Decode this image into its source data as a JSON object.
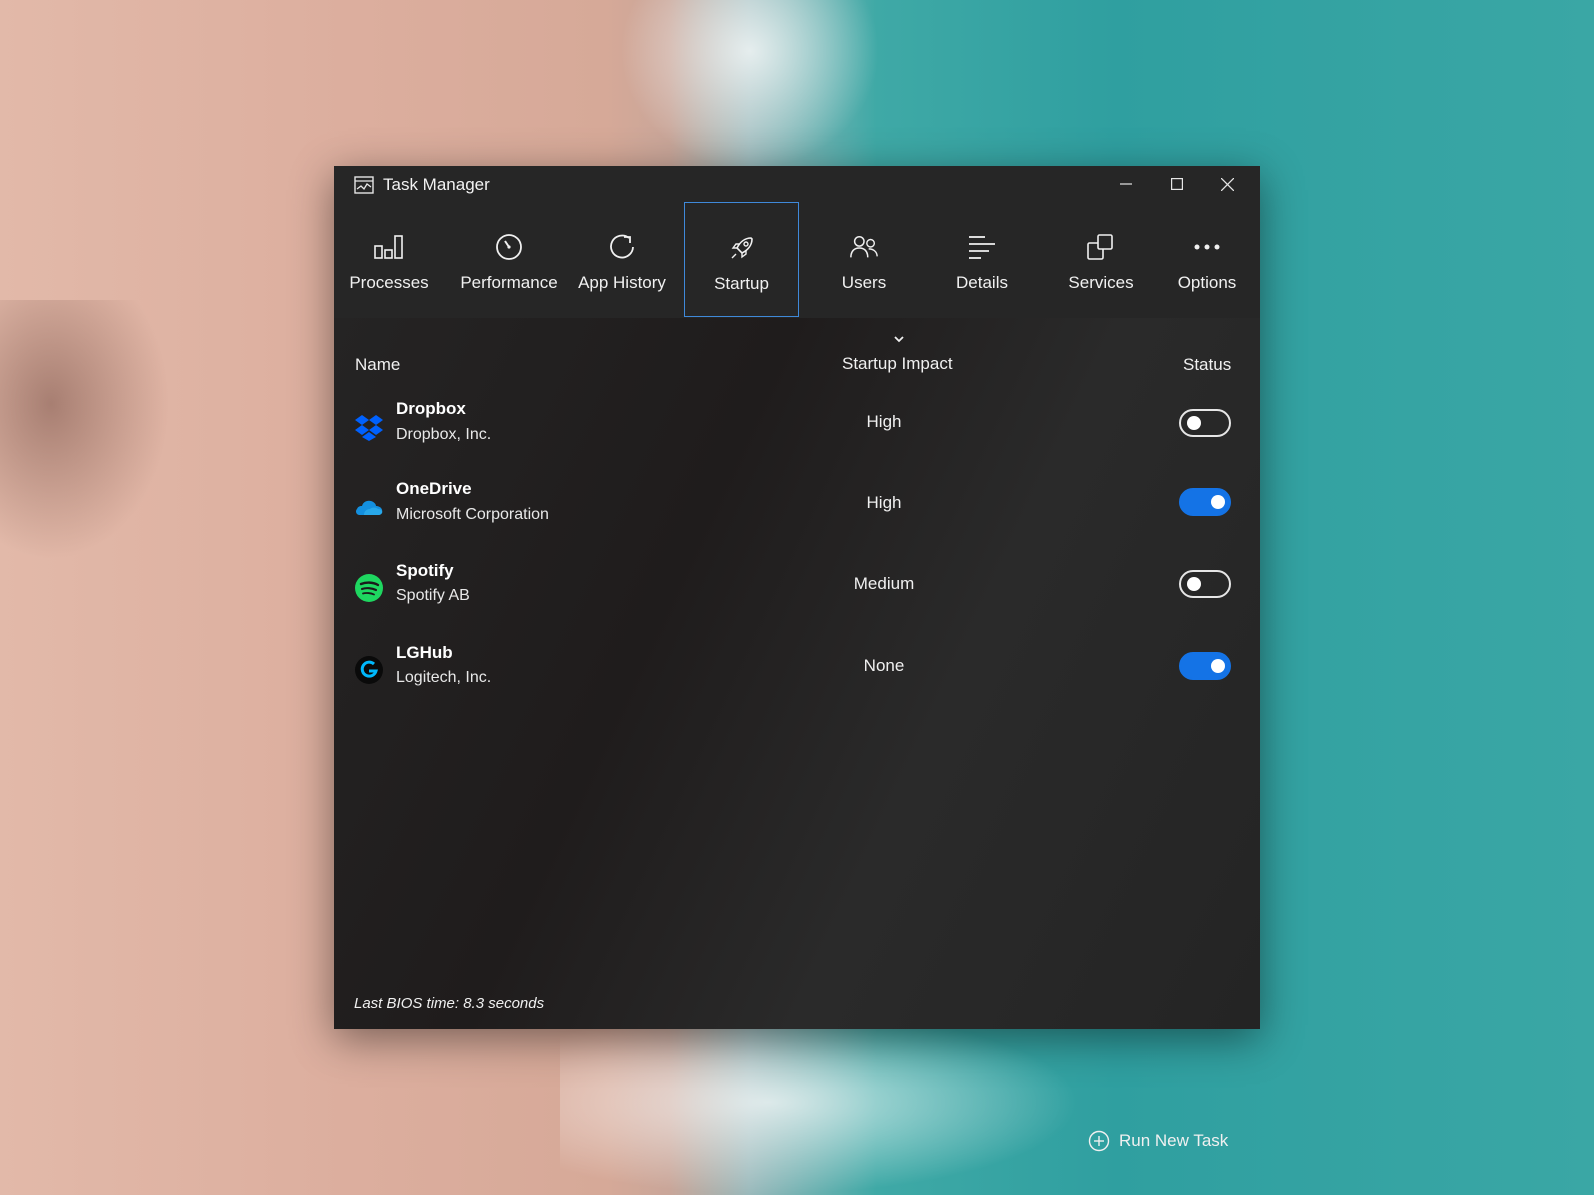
{
  "window": {
    "title": "Task Manager"
  },
  "tabs": [
    {
      "label": "Processes",
      "icon": "processes-icon"
    },
    {
      "label": "Performance",
      "icon": "performance-icon"
    },
    {
      "label": "App History",
      "icon": "app-history-icon"
    },
    {
      "label": "Startup",
      "icon": "rocket-icon",
      "active": true
    },
    {
      "label": "Users",
      "icon": "users-icon"
    },
    {
      "label": "Details",
      "icon": "details-icon"
    },
    {
      "label": "Services",
      "icon": "services-icon"
    },
    {
      "label": "Options",
      "icon": "more-icon"
    }
  ],
  "table": {
    "columns": {
      "name": "Name",
      "impact": "Startup Impact",
      "status": "Status"
    },
    "rows": [
      {
        "name": "Dropbox",
        "publisher": "Dropbox, Inc.",
        "impact": "High",
        "enabled": false,
        "icon": "dropbox-icon",
        "icon_color": "#0061fe"
      },
      {
        "name": "OneDrive",
        "publisher": "Microsoft Corporation",
        "impact": "High",
        "enabled": true,
        "icon": "onedrive-icon",
        "icon_color": "#1490df"
      },
      {
        "name": "Spotify",
        "publisher": "Spotify AB",
        "impact": "Medium",
        "enabled": false,
        "icon": "spotify-icon",
        "icon_color": "#1ed760"
      },
      {
        "name": "LGHub",
        "publisher": "Logitech, Inc.",
        "impact": "None",
        "enabled": true,
        "icon": "logitech-icon",
        "icon_color": "#00b8fc"
      }
    ]
  },
  "footer": {
    "bios_time": "Last BIOS time: 8.3 seconds",
    "run_new_task": "Run New Task"
  },
  "colors": {
    "accent": "#1473e6",
    "active_tab_border": "#3f89d9"
  }
}
